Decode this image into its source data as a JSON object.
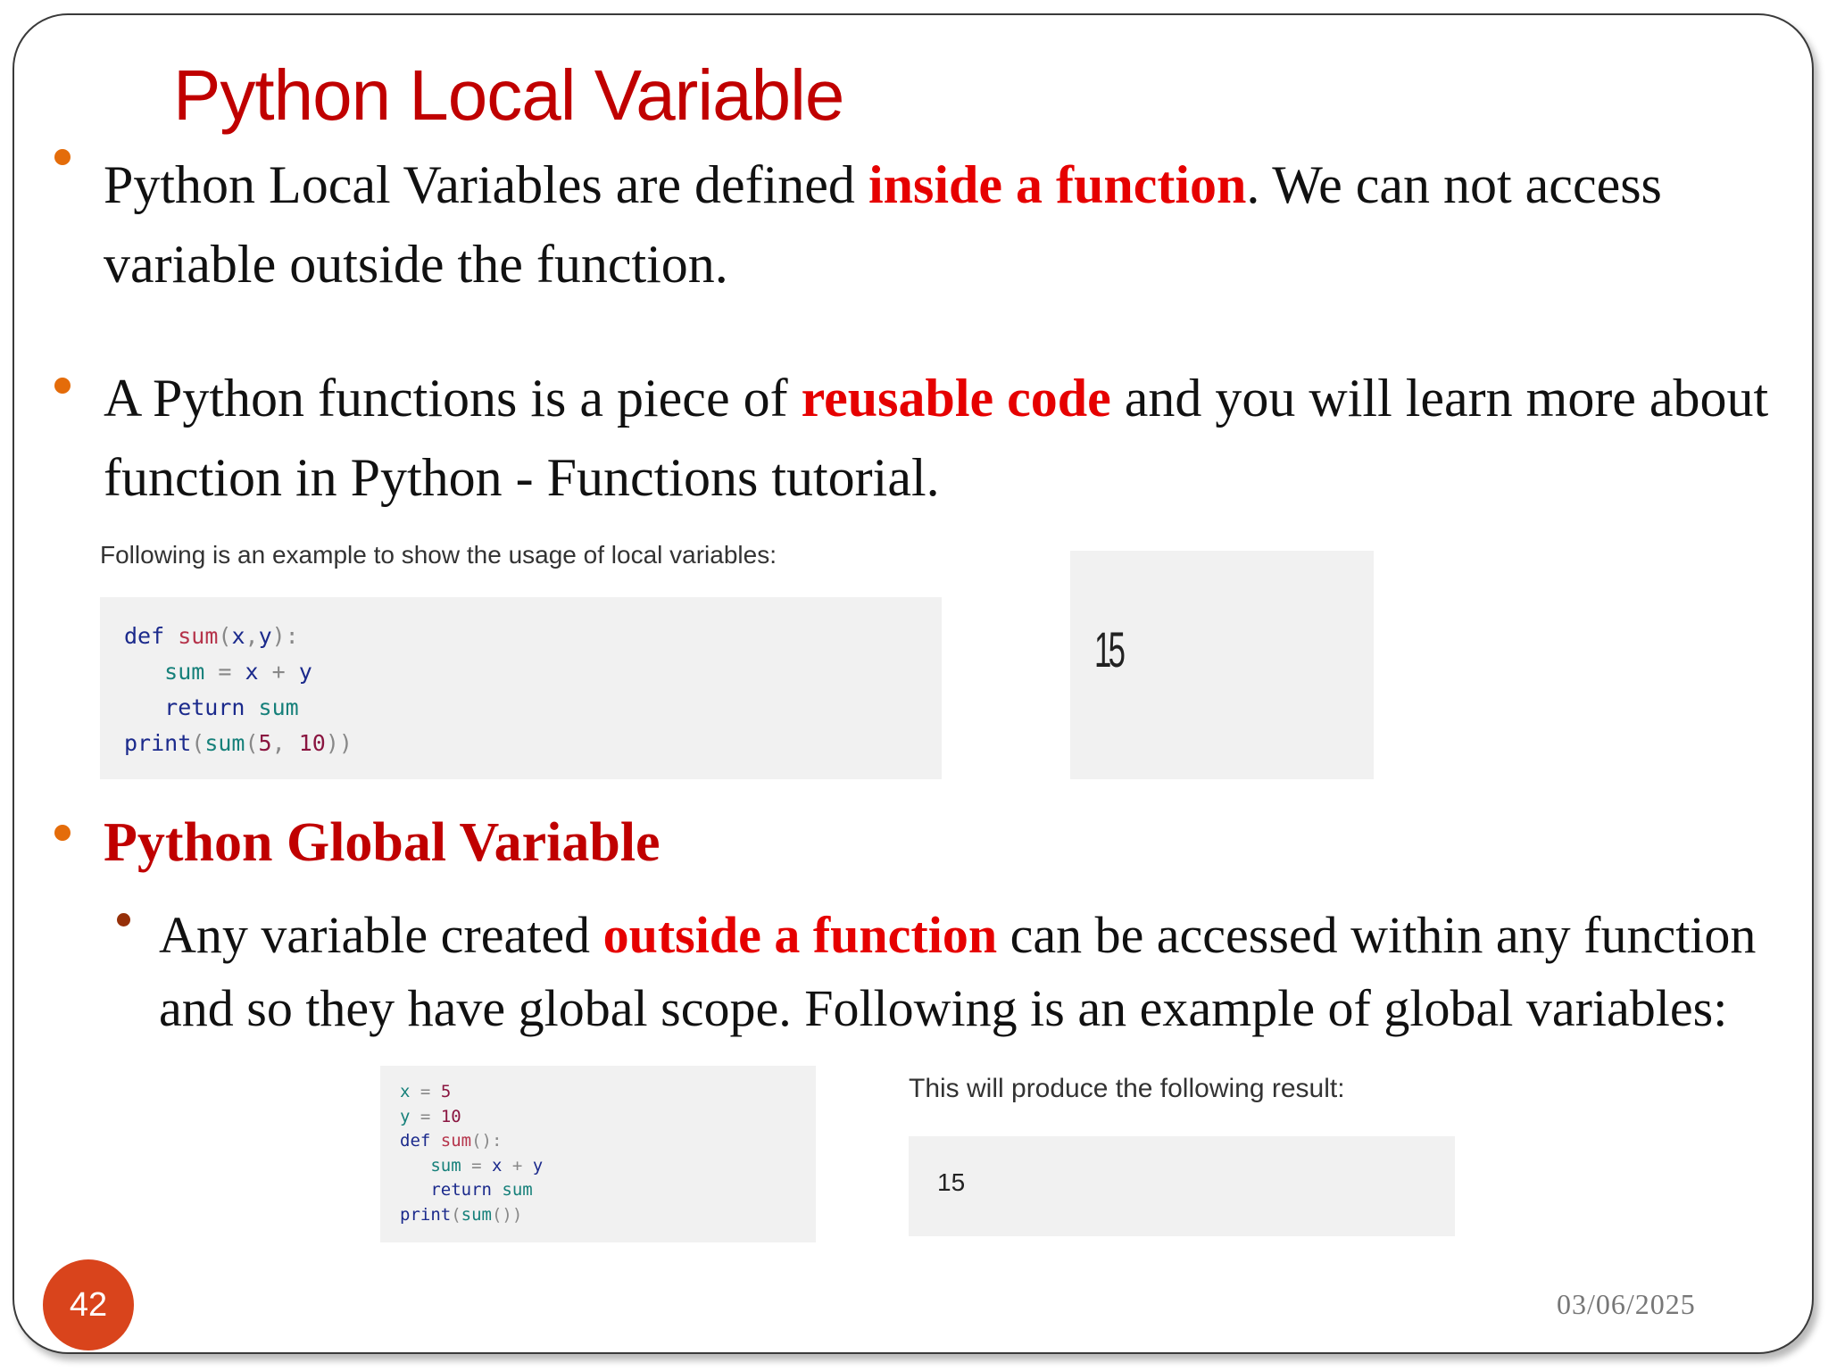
{
  "title": "Python Local Variable",
  "bullet1": {
    "pre": "Python Local Variables are defined ",
    "highlight": "inside a function",
    "post": ". We can not access variable outside the function."
  },
  "bullet2": {
    "pre": "A Python functions is a piece of ",
    "highlight": "reusable code",
    "post": " and you will learn more about function in Python - Functions tutorial."
  },
  "example1": {
    "caption": "Following is an example to show the usage of local variables:",
    "output": "15"
  },
  "bullet3": {
    "heading": "Python Global Variable"
  },
  "sub_bullet": {
    "pre": "Any variable created ",
    "highlight": "outside a function",
    "post": " can be accessed within any function and so they have global scope. Following is an example of global variables:"
  },
  "example2": {
    "caption": "This will produce the following result:",
    "output": "15"
  },
  "footer": {
    "page_number": "42",
    "date": "03/06/2025"
  },
  "colors": {
    "title": "#c00000",
    "highlight": "#e60000",
    "bullet": "#e46c0a",
    "page_badge": "#d9441c"
  }
}
